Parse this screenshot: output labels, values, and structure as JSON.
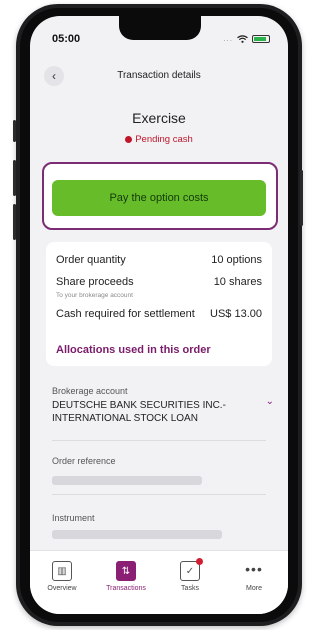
{
  "status_bar": {
    "time": "05:00",
    "signal_dots": "...",
    "wifi_icon": "wifi-icon",
    "battery_icon": "battery-icon"
  },
  "header": {
    "title": "Transaction details",
    "back_icon": "chevron-left-icon",
    "back_glyph": "‹"
  },
  "transaction": {
    "title": "Exercise",
    "status": "Pending cash",
    "status_color": "#c0162c"
  },
  "actions": {
    "pay_label": "Pay the option costs",
    "pay_color": "#66bc29",
    "highlight_color": "#7b2d73"
  },
  "summary": {
    "order_quantity_label": "Order quantity",
    "order_quantity_value": "10 options",
    "share_proceeds_label": "Share proceeds",
    "share_proceeds_value": "10 shares",
    "share_proceeds_note": "To your brokerage account",
    "cash_required_label": "Cash required for settlement",
    "cash_required_value": "US$ 13.00",
    "allocations_link": "Allocations used in this order"
  },
  "details": {
    "brokerage_label": "Brokerage account",
    "brokerage_line1": "DEUTSCHE BANK SECURITIES INC.-",
    "brokerage_line2": "INTERNATIONAL STOCK LOAN",
    "brokerage_chevron": "chevron-down-icon",
    "brokerage_chevron_glyph": "⌄",
    "order_reference_label": "Order reference",
    "instrument_label": "Instrument"
  },
  "tabbar": {
    "items": [
      {
        "label": "Overview",
        "icon": "overview-icon",
        "glyph": "▥"
      },
      {
        "label": "Transactions",
        "icon": "transactions-icon",
        "glyph": "⇅"
      },
      {
        "label": "Tasks",
        "icon": "tasks-icon",
        "glyph": "✓"
      },
      {
        "label": "More",
        "icon": "more-icon",
        "glyph": "•••"
      }
    ],
    "active": "Transactions",
    "accent_color": "#8a1f73"
  }
}
